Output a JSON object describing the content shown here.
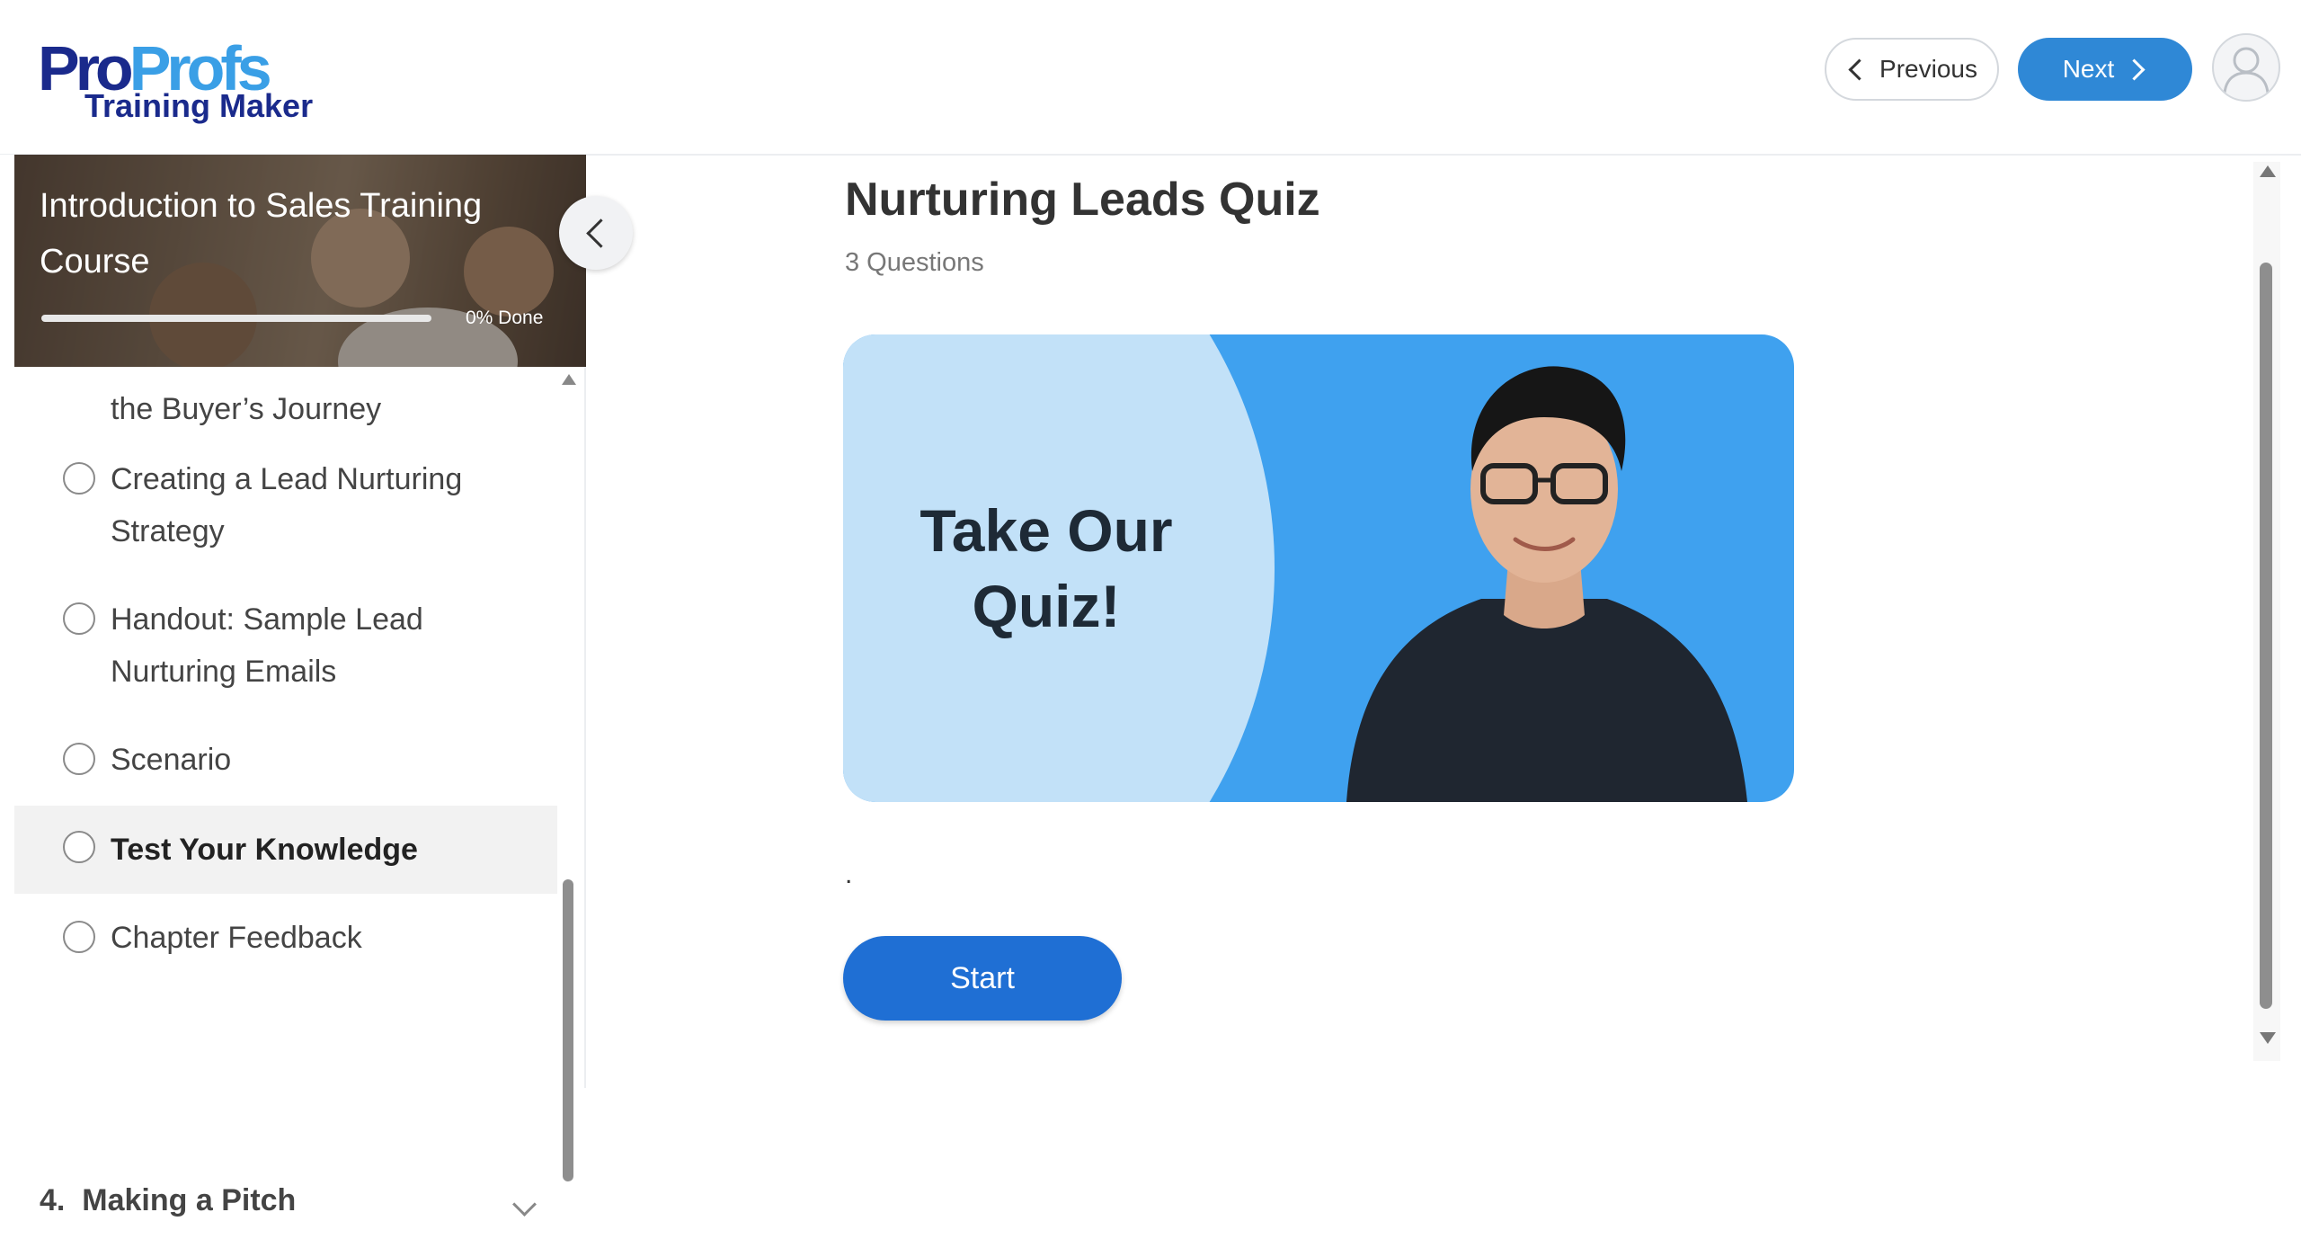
{
  "header": {
    "logo_pro": "Pro",
    "logo_profs": "Profs",
    "logo_sub": "Training Maker",
    "previous_label": "Previous",
    "next_label": "Next"
  },
  "sidebar": {
    "course_title": "Introduction to Sales Training Course",
    "progress_percent": 0,
    "progress_label": "0% Done",
    "partial_item": "the Buyer’s Journey",
    "lessons": [
      {
        "label": "Creating a Lead Nurturing Strategy",
        "active": false
      },
      {
        "label": "Handout: Sample Lead Nurturing Emails",
        "active": false
      },
      {
        "label": "Scenario",
        "active": false
      },
      {
        "label": "Test Your Knowledge",
        "active": true
      },
      {
        "label": "Chapter Feedback",
        "active": false
      }
    ],
    "module": {
      "number": "4.",
      "title": "Making a Pitch"
    }
  },
  "main": {
    "quiz_title": "Nurturing Leads Quiz",
    "question_count": "3 Questions",
    "hero_text_line1": "Take Our",
    "hero_text_line2": "Quiz!",
    "body_text": ".",
    "start_label": "Start"
  },
  "colors": {
    "accent": "#2f88d6",
    "start_button": "#1f6fd4",
    "hero_bg": "#3fa1ef",
    "hero_circle": "#c2e1f8",
    "logo_dark": "#1a2a8c",
    "logo_light": "#3a9fe6"
  },
  "icons": {
    "previous": "chevron-left-icon",
    "next": "chevron-right-icon",
    "avatar": "user-avatar-icon",
    "collapse": "chevron-left-icon",
    "module_expand": "chevron-down-icon"
  }
}
